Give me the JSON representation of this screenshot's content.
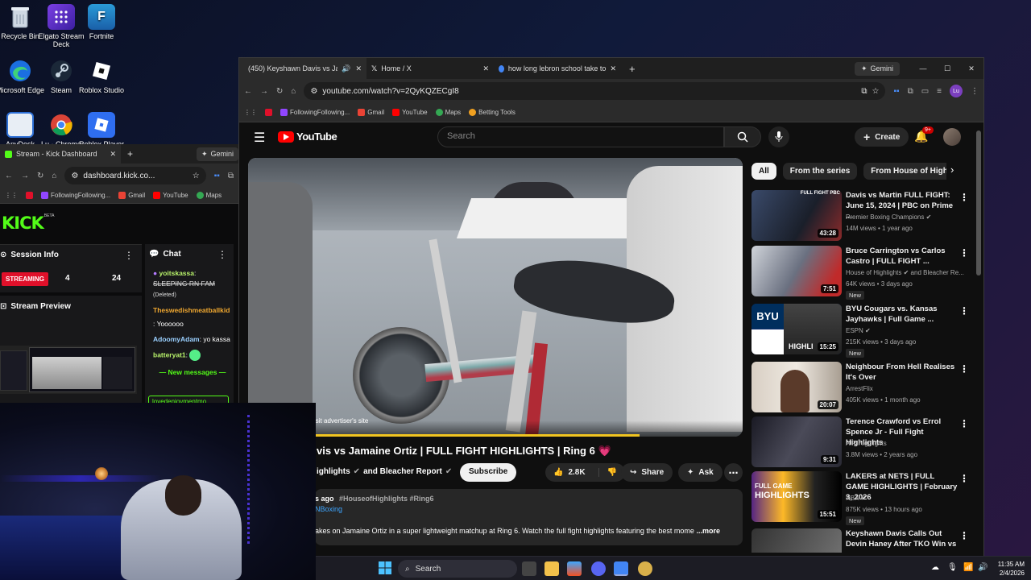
{
  "desktop": {
    "icons": [
      {
        "label": "Recycle Bin"
      },
      {
        "label": "Elgato Stream Deck"
      },
      {
        "label": "Fortnite"
      },
      {
        "label": "Microsoft Edge"
      },
      {
        "label": "Steam"
      },
      {
        "label": "Roblox Studio"
      },
      {
        "label": "AnyDesk"
      },
      {
        "label": "Lu - Chrome"
      },
      {
        "label": "Roblox Player"
      }
    ]
  },
  "kick_window": {
    "tab_title": "Stream - Kick Dashboard",
    "gemini": "Gemini",
    "url": "dashboard.kick.co...",
    "bookmarks": [
      "FollowingFollowing...",
      "Gmail",
      "YouTube",
      "Maps"
    ],
    "logo": "KICK",
    "logo_badge": "BETA",
    "session_title": "Session Info",
    "streaming_badge": "STREAMING",
    "stat_a": "4",
    "stat_b": "24",
    "preview_title": "Stream Preview",
    "chat_title": "Chat",
    "chat": [
      {
        "user": "yoitskassa",
        "text": "SLEEPING RN FAM",
        "note": "(Deleted)"
      },
      {
        "user": "Theswedishmeatballkid",
        "text": ": Yoooooo"
      },
      {
        "user": "AdoomyAdam",
        "text": ": yo kassa"
      },
      {
        "user": "batteryat1",
        "text": ":"
      }
    ],
    "new_messages": "New messages",
    "input_user": "lovedenjoymentmo"
  },
  "chrome": {
    "tabs": [
      {
        "title": "(450) Keyshawn Davis vs Ja"
      },
      {
        "title": "Home / X"
      },
      {
        "title": "how long lebron school take to"
      }
    ],
    "gemini": "Gemini",
    "url": "youtube.com/watch?v=2QyKQZECgI8",
    "bookmarks": [
      "FollowingFollowing...",
      "Gmail",
      "YouTube",
      "Maps",
      "Betting Tools"
    ],
    "profile_initials": "Lu"
  },
  "youtube": {
    "logo": "YouTube",
    "search_placeholder": "Search",
    "create": "Create",
    "notif_count": "9+",
    "ad_text": "isit advertiser's site",
    "video_title": "vis vs Jamaine Ortiz | FULL FIGHT HIGHLIGHTS | Ring 6",
    "channel": "ighlights",
    "channel2": "and Bleacher Report",
    "subscribe": "Subscribe",
    "likes": "2.8K",
    "share": "Share",
    "ask": "Ask",
    "desc_time": "s ago",
    "desc_tags": "#HouseofHighlights #Ring6",
    "desc_link": "NBoxing",
    "desc_text": "akes on Jamaine Ortiz in a super lightweight matchup at Ring 6. Watch the full fight highlights featuring the best mome",
    "desc_more": "...more",
    "chips": [
      "All",
      "From the series",
      "From House of Highlights"
    ],
    "recs": [
      {
        "title": "Davis vs Martin FULL FIGHT: June 15, 2024 | PBC on Prime ...",
        "channel": "Premier Boxing Champions",
        "meta": "14M views • 1 year ago",
        "duration": "43:28",
        "new": ""
      },
      {
        "title": "Bruce Carrington vs Carlos Castro | FULL FIGHT ...",
        "channel": "House of Highlights",
        "channel_extra": "and Bleacher Re...",
        "meta": "64K views • 3 days ago",
        "duration": "7:51",
        "new": "New"
      },
      {
        "title": "BYU Cougars vs. Kansas Jayhawks | Full Game ...",
        "channel": "ESPN",
        "meta": "215K views • 3 days ago",
        "duration": "15:25",
        "new": "New"
      },
      {
        "title": "Neighbour From Hell Realises It's Over",
        "channel": "ArrestFlix",
        "meta": "405K views • 1 month ago",
        "duration": "20:07",
        "new": ""
      },
      {
        "title": "Terence Crawford vs Errol Spence Jr - Full Fight Highlights",
        "channel": "AIR Highlights",
        "meta": "3.8M views • 2 years ago",
        "duration": "9:31",
        "new": ""
      },
      {
        "title": "LAKERS at NETS | FULL GAME HIGHLIGHTS | February 3, 2026",
        "channel": "NBA",
        "meta": "875K views • 13 hours ago",
        "duration": "15:51",
        "new": "New"
      },
      {
        "title": "Keyshawn Davis Calls Out Devin Haney After TKO Win vs ...",
        "channel": "",
        "meta": "",
        "duration": "",
        "new": ""
      }
    ],
    "thumb_texts": {
      "t1_badge": "FULL FIGHT PBC",
      "t3": "HIGHLI",
      "t6a": "FULL GAME",
      "t6b": "HIGHLIGHTS"
    }
  },
  "taskbar": {
    "search": "Search",
    "time": "11:35 AM",
    "date": "2/4/2026"
  },
  "colors": {
    "kick_green": "#53fc18",
    "yt_red": "#ff0000",
    "streaming_red": "#e0102a",
    "edge_blue": "#1b6fe0"
  }
}
